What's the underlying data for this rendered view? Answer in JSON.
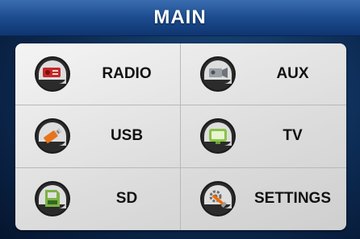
{
  "header": {
    "title": "MAIN"
  },
  "menu": {
    "items": [
      {
        "label": "RADIO",
        "icon": "radio-icon"
      },
      {
        "label": "AUX",
        "icon": "aux-icon"
      },
      {
        "label": "USB",
        "icon": "usb-icon"
      },
      {
        "label": "TV",
        "icon": "tv-icon"
      },
      {
        "label": "SD",
        "icon": "sd-card-icon"
      },
      {
        "label": "SETTINGS",
        "icon": "settings-icon"
      }
    ]
  },
  "colors": {
    "title_bar": "#1c4c8f",
    "panel": "#e6e6e6",
    "icon_disc": "#1a1a1a",
    "icon_page": "#f2f2f2"
  }
}
